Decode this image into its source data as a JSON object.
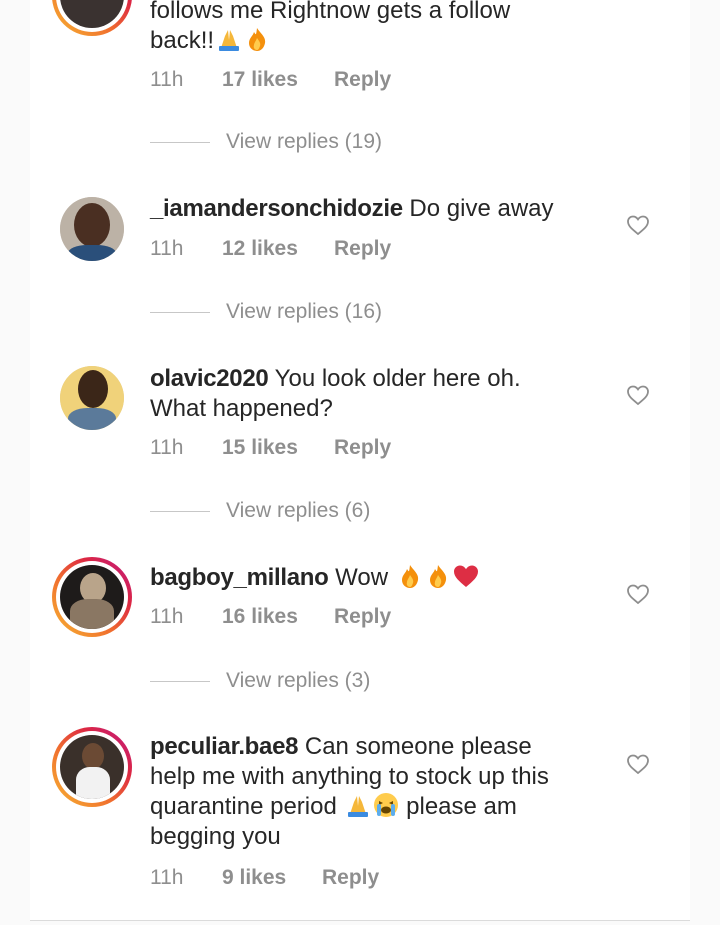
{
  "comments": [
    {
      "username": "",
      "text": "follows me Rightnow gets a follow back!!",
      "text_lines": [
        "follows me Rightnow gets a follow",
        "back!!"
      ],
      "time": "11h",
      "likes": "17 likes",
      "reply": "Reply",
      "view_replies": "View replies (19)"
    },
    {
      "username": "_iamandersonchidozie",
      "text": "Do give away",
      "time": "11h",
      "likes": "12 likes",
      "reply": "Reply",
      "view_replies": "View replies (16)"
    },
    {
      "username": "olavic2020",
      "text": "You look older here oh. What happened?",
      "text_line2": "What happened?",
      "time": "11h",
      "likes": "15 likes",
      "reply": "Reply",
      "view_replies": "View replies (6)"
    },
    {
      "username": "bagboy_millano",
      "text": "Wow",
      "time": "11h",
      "likes": "16 likes",
      "reply": "Reply",
      "view_replies": "View replies (3)"
    },
    {
      "username": "peculiar.bae8",
      "text_part1": "Can someone please",
      "text_line2": "help me with anything to stock up this",
      "text_line3a": "quarantine period",
      "text_line3b": "please am",
      "text_line4": "begging you",
      "time": "11h",
      "likes": "9 likes",
      "reply": "Reply"
    }
  ],
  "colors": {
    "text": "#262626",
    "meta": "#8e8e8e",
    "story_ring": [
      "#f7b733",
      "#f06f2e",
      "#dc2743",
      "#bc1888"
    ]
  },
  "icons": [
    "heart-outline-icon",
    "folded-hands-emoji",
    "fire-emoji",
    "red-heart-emoji",
    "crying-face-emoji"
  ]
}
